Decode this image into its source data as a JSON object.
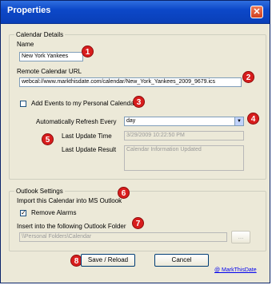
{
  "window": {
    "title": "Properties",
    "close_glyph": "✕"
  },
  "calendar_details": {
    "legend": "Calendar Details",
    "name_label": "Name",
    "name_value": "New York Yankees",
    "url_label": "Remote Calendar URL",
    "url_value": "webcal://www.markthisdate.com/calendar/New_York_Yankees_2009_9679.ics",
    "add_events_label": "Add Events to my Personal Calendar",
    "refresh_label": "Automatically Refresh Every",
    "refresh_value": "day",
    "last_update_time_label": "Last Update Time",
    "last_update_time_value": "3/29/2009 10:22:50 PM",
    "last_update_result_label": "Last Update Result",
    "last_update_result_value": "Calendar Information Updated"
  },
  "outlook_settings": {
    "legend": "Outlook Settings",
    "import_label": "Import this Calendar into MS Outlook",
    "remove_alarms_label": "Remove Alarms",
    "remove_alarms_checked": "✓",
    "folder_label": "Insert into the following Outlook Folder",
    "folder_value": "\\\\Personal Folders\\Calendar",
    "browse_label": "..."
  },
  "buttons": {
    "save": "Save / Reload",
    "cancel": "Cancel"
  },
  "footer": {
    "link": "@ MarkThisDate"
  },
  "badges": {
    "b1": "1",
    "b2": "2",
    "b3": "3",
    "b4": "4",
    "b5": "5",
    "b6": "6",
    "b7": "7",
    "b8": "8"
  },
  "colors": {
    "title_bar": "#0c48c8",
    "badge": "#d81d1d",
    "dialog_bg": "#ece9d8"
  }
}
